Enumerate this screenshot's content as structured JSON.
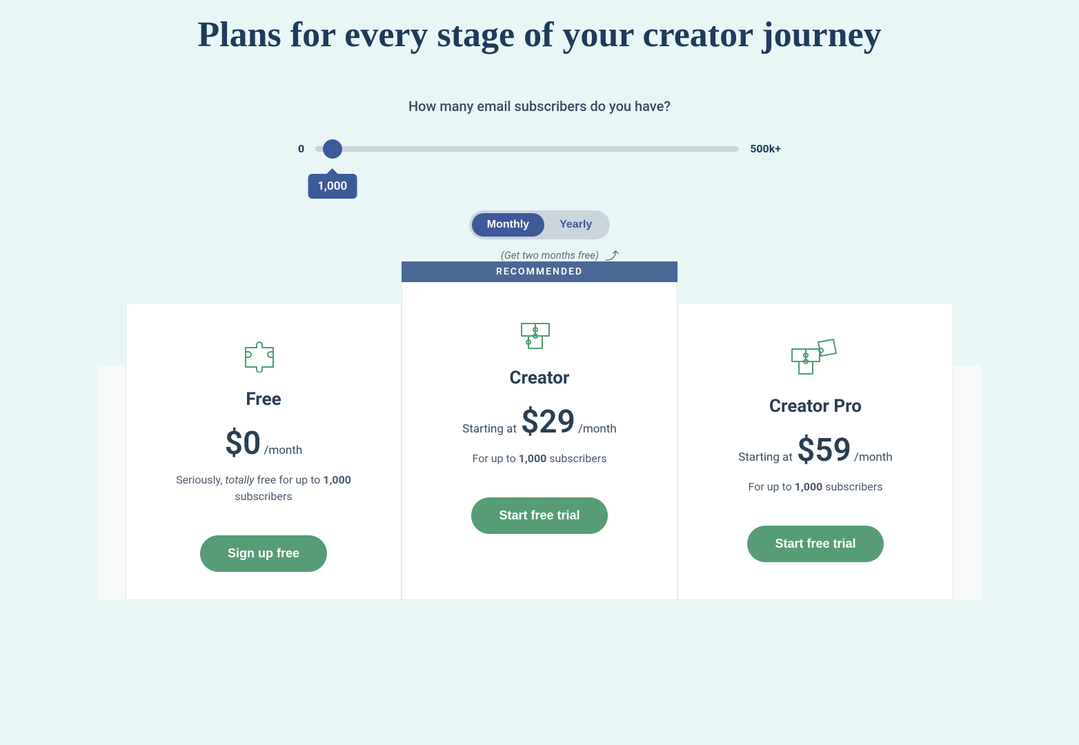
{
  "heading": "Plans for every stage of your creator journey",
  "slider": {
    "prompt": "How many email subscribers do you have?",
    "min_label": "0",
    "max_label": "500k+",
    "value_display": "1,000"
  },
  "billing": {
    "monthly": "Monthly",
    "yearly": "Yearly",
    "promo": "(Get two months free)"
  },
  "recommended_badge": "RECOMMENDED",
  "plans": {
    "free": {
      "name": "Free",
      "price_prefix": "",
      "price": "$0",
      "price_suffix": "/month",
      "sub_pre": "Seriously, ",
      "sub_em": "totally",
      "sub_mid": " free for up to ",
      "sub_strong": "1,000",
      "sub_post": " subscribers",
      "cta": "Sign up free"
    },
    "creator": {
      "name": "Creator",
      "price_prefix": "Starting at",
      "price": "$29",
      "price_suffix": "/month",
      "sub_pre": "For up to ",
      "sub_strong": "1,000",
      "sub_post": " subscribers",
      "cta": "Start free trial"
    },
    "pro": {
      "name": "Creator Pro",
      "price_prefix": "Starting at",
      "price": "$59",
      "price_suffix": "/month",
      "sub_pre": "For up to ",
      "sub_strong": "1,000",
      "sub_post": " subscribers",
      "cta": "Start free trial"
    }
  }
}
